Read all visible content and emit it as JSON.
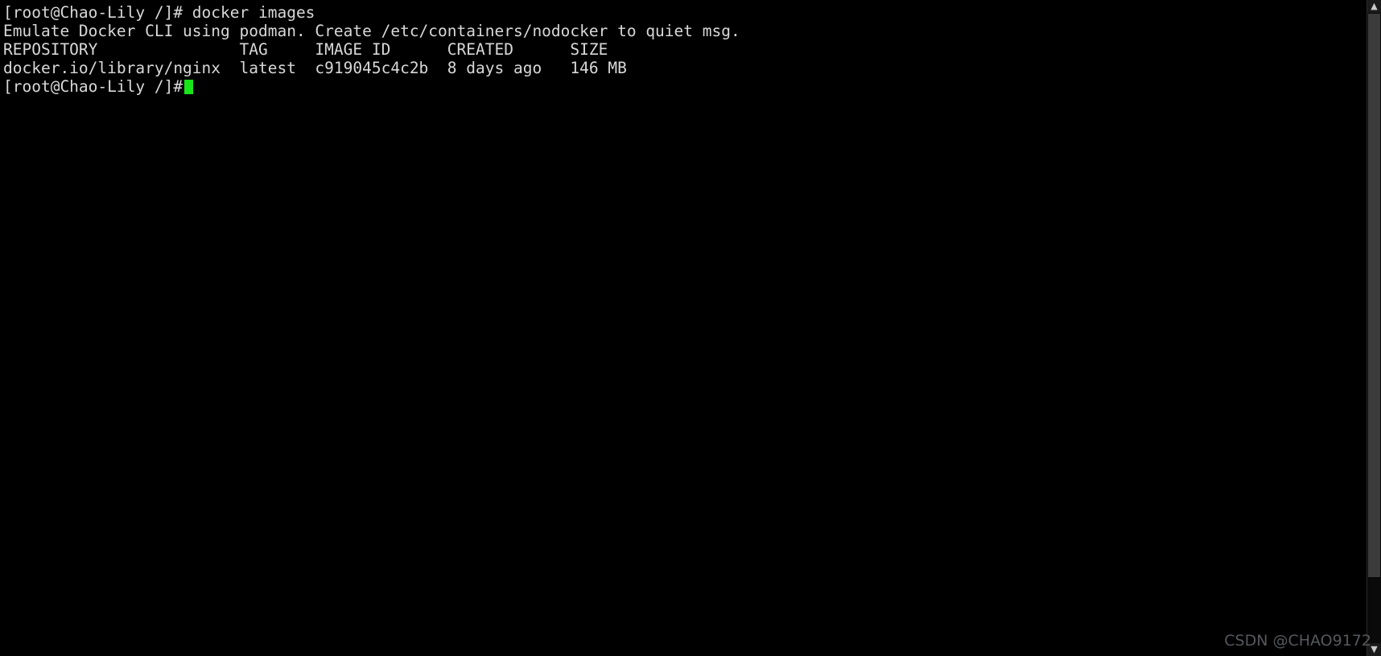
{
  "terminal": {
    "prompt": "[root@Chao-Lily /]#",
    "lines": [
      "[root@Chao-Lily /]# docker images",
      "Emulate Docker CLI using podman. Create /etc/containers/nodocker to quiet msg.",
      "REPOSITORY               TAG     IMAGE ID      CREATED      SIZE",
      "docker.io/library/nginx  latest  c919045c4c2b  8 days ago   146 MB",
      "[root@Chao-Lily /]# "
    ],
    "command": "docker images",
    "notice": "Emulate Docker CLI using podman. Create /etc/containers/nodocker to quiet msg.",
    "table": {
      "headers": [
        "REPOSITORY",
        "TAG",
        "IMAGE ID",
        "CREATED",
        "SIZE"
      ],
      "rows": [
        [
          "docker.io/library/nginx",
          "latest",
          "c919045c4c2b",
          "8 days ago",
          "146 MB"
        ]
      ]
    },
    "colors": {
      "background": "#000000",
      "foreground": "#d8d8d8",
      "cursor": "#19e619"
    }
  },
  "scrollbar": {
    "up_arrow": "▲",
    "down_arrow": "▼"
  },
  "watermark": {
    "text": "CSDN @CHAO9172"
  }
}
